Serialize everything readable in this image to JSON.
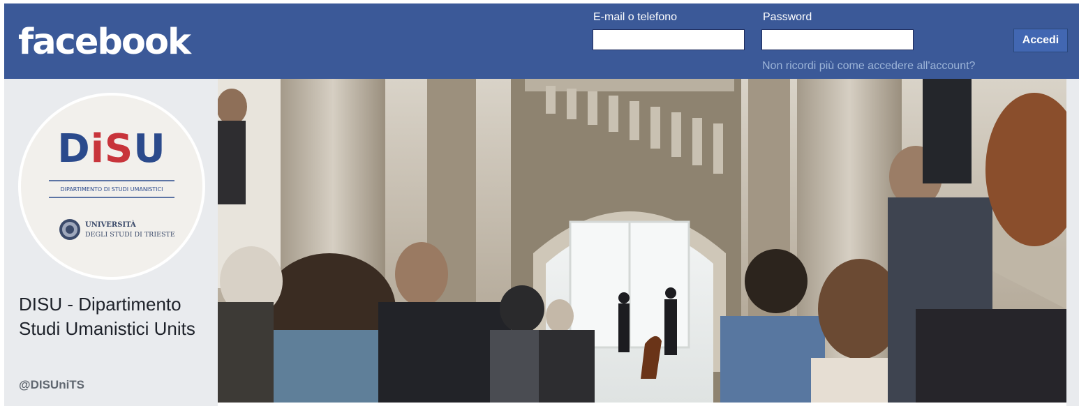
{
  "header": {
    "logo_text": "facebook",
    "email_label": "E-mail o telefono",
    "email_value": "",
    "password_label": "Password",
    "password_value": "",
    "login_button": "Accedi",
    "forgot_link": "Non ricordi più come accedere all'account?"
  },
  "profile": {
    "avatar": {
      "logo_text": "DiSU",
      "department_line": "DIPARTIMENTO DI STUDI UMANISTICI",
      "university_line1": "UNIVERSITÀ",
      "university_line2": "DEGLI STUDI DI TRIESTE"
    },
    "page_name": "DISU - Dipartimento Studi Umanistici Units",
    "handle": "@DISUniTS"
  },
  "colors": {
    "brand_blue": "#3b5998",
    "button_blue": "#4267b2",
    "sidebar_bg": "#e9ebee",
    "disu_blue": "#2b4a8c",
    "disu_red": "#c8343b"
  }
}
